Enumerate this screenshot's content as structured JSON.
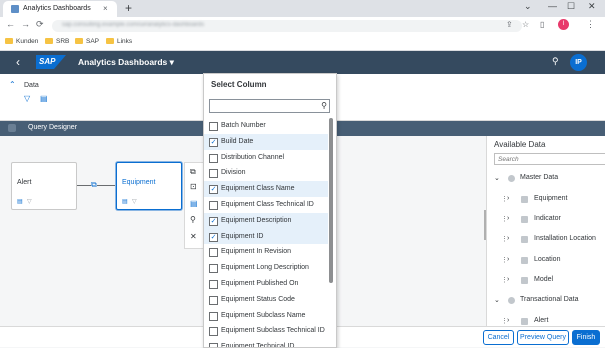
{
  "browser": {
    "tab_title": "Analytics Dashboards",
    "tab_close": "×",
    "new_tab": "+",
    "url": "sap.consulting.example.com/ui#analytics-dashboards",
    "bookmarks": [
      "Kunden",
      "SRB",
      "SAP",
      "Links"
    ],
    "nav": {
      "back": "←",
      "forward": "→",
      "reload": "⟳"
    },
    "window_controls": {
      "collapse": "⌄",
      "minimize": "—",
      "maximize": "☐",
      "close": "✕"
    },
    "profile_initial": "I"
  },
  "shell": {
    "back": "‹",
    "logo": "SAP",
    "title": "Analytics Dashboards ▾",
    "user_initials": "IP"
  },
  "data_header": {
    "collapse_icon": "⌃",
    "label": "Data"
  },
  "query_designer": {
    "label": "Query Designer"
  },
  "nodes": {
    "alert": {
      "name": "Alert"
    },
    "equipment": {
      "name": "Equipment"
    }
  },
  "context_menu": [
    "⧉",
    "⊡",
    "▤",
    "⚲",
    "✕"
  ],
  "dropdown": {
    "header": "Select Column",
    "search_placeholder": "",
    "items": [
      {
        "label": "Batch Number",
        "checked": false
      },
      {
        "label": "Build Date",
        "checked": true
      },
      {
        "label": "Distribution Channel",
        "checked": false
      },
      {
        "label": "Division",
        "checked": false
      },
      {
        "label": "Equipment Class Name",
        "checked": true
      },
      {
        "label": "Equipment Class Technical ID",
        "checked": false
      },
      {
        "label": "Equipment Description",
        "checked": true
      },
      {
        "label": "Equipment ID",
        "checked": true
      },
      {
        "label": "Equipment In Revision",
        "checked": false
      },
      {
        "label": "Equipment Long Description",
        "checked": false
      },
      {
        "label": "Equipment Published On",
        "checked": false
      },
      {
        "label": "Equipment Status Code",
        "checked": false
      },
      {
        "label": "Equipment Subclass Name",
        "checked": false
      },
      {
        "label": "Equipment Subclass Technical ID",
        "checked": false
      },
      {
        "label": "Equipment Technical ID",
        "checked": false
      }
    ]
  },
  "available_data": {
    "title": "Available Data",
    "search_placeholder": "Search",
    "groups": [
      {
        "label": "Master Data",
        "items": [
          "Equipment",
          "Indicator",
          "Installation Location",
          "Location",
          "Model"
        ]
      },
      {
        "label": "Transactional Data",
        "items": [
          "Alert"
        ]
      }
    ]
  },
  "footer": {
    "cancel": "Cancel",
    "preview": "Preview Query",
    "finish": "Finish"
  }
}
